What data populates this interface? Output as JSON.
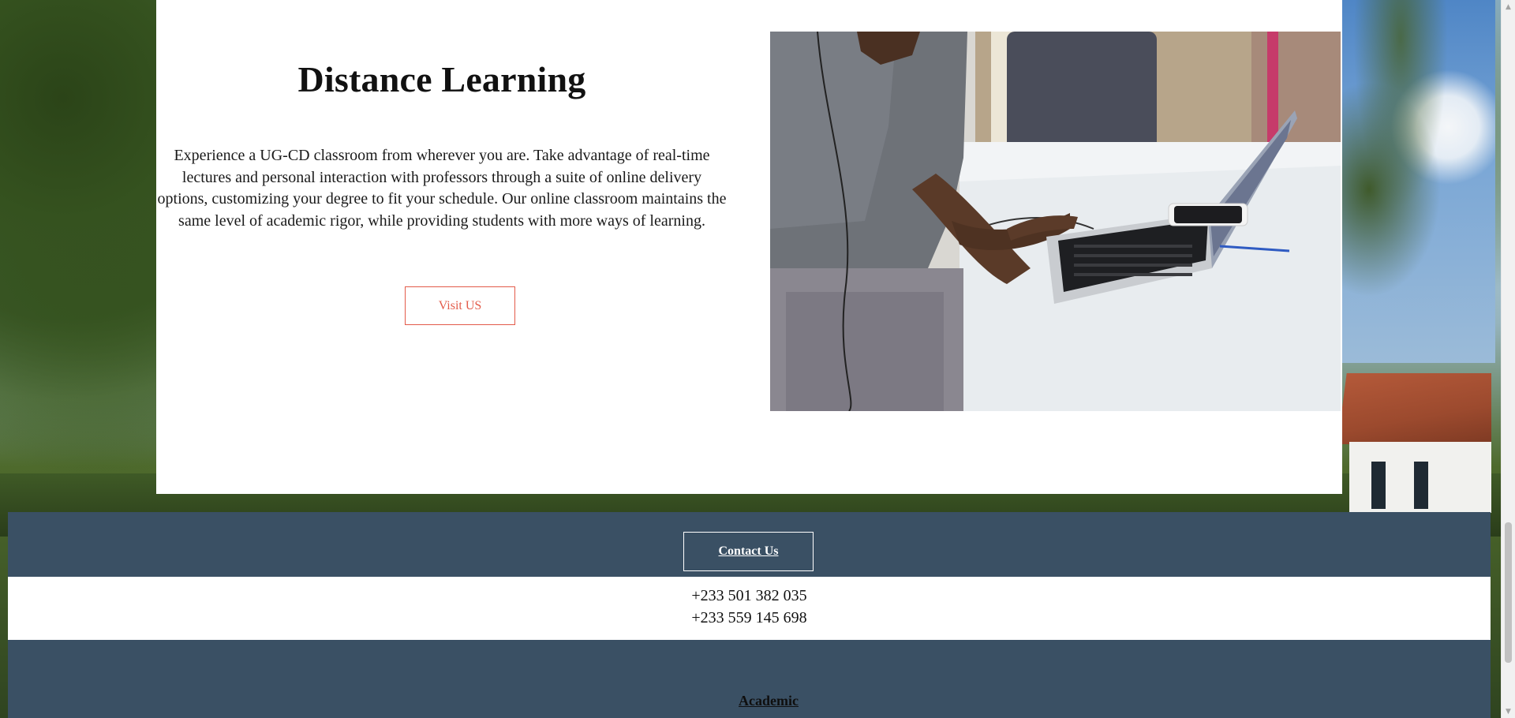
{
  "section": {
    "heading": "Distance Learning",
    "description": "Experience a UG-CD classroom from wherever you are. Take advantage of real-time lectures and personal interaction with professors through a suite of online delivery options, customizing your degree to fit your schedule. Our online classroom maintains the same level of academic rigor, while providing students with more ways of learning.",
    "visit_button_label": "Visit US",
    "image_icon": "student-laptop-photo"
  },
  "footer": {
    "contact_button_label": "Contact Us",
    "phones": [
      "+233 501 382 035",
      "+233 559 145 698"
    ],
    "academic_heading": "Academic"
  },
  "colors": {
    "accent": "#e35b4a",
    "footer_bg": "#3a5064",
    "card_bg": "#ffffff"
  },
  "scrollbar": {
    "icons": [
      "scroll-up-icon",
      "scroll-down-icon"
    ]
  }
}
